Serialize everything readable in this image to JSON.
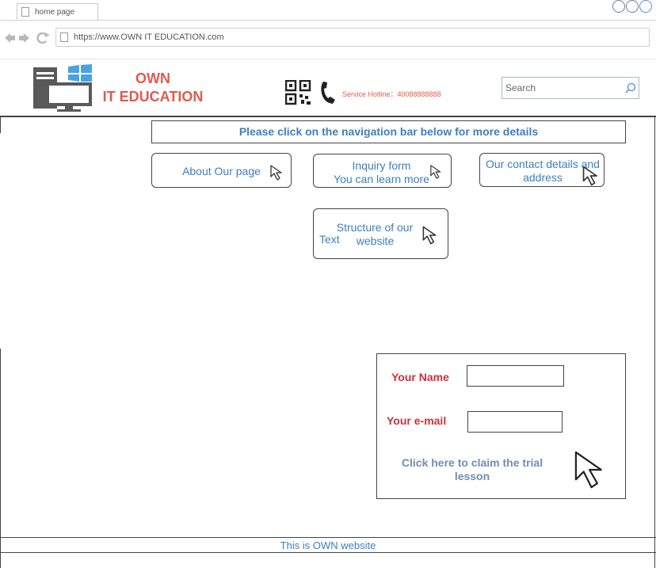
{
  "browser": {
    "tab_title": "home page",
    "url": "https://www.OWN IT EDUCATION.com"
  },
  "header": {
    "logo_line1": "OWN",
    "logo_line2": "IT EDUCATION",
    "hotline": "Service Hotline：40088888888",
    "search_placeholder": "Search"
  },
  "banner": "Please click on the navigation bar below for more details",
  "nav": {
    "about": "About Our page",
    "inquiry_line1": "Inquiry form",
    "inquiry_line2": "You can learn more",
    "contact_line1": "Our contact details and",
    "contact_line2": "address",
    "structure_line1": "Structure of our",
    "structure_prefix": "Text",
    "structure_line2": "website"
  },
  "form": {
    "name_label": "Your Name",
    "email_label": "Your e-mail",
    "claim_line1": "Click here to claim the trial",
    "claim_line2": "lesson"
  },
  "footer": "This is OWN website",
  "colors": {
    "accent_blue": "#3b7fc0",
    "logo_red": "#e05a4e",
    "label_red": "#c8323a"
  }
}
